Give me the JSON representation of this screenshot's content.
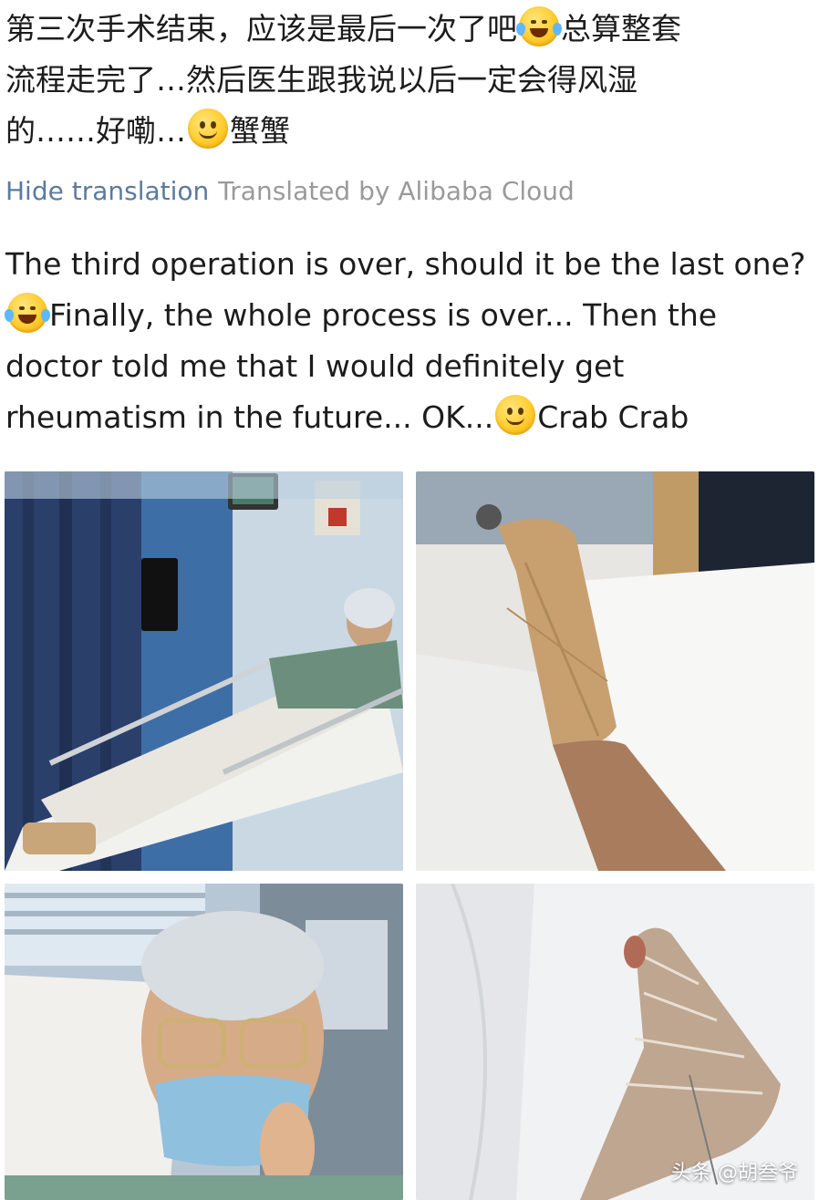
{
  "post": {
    "line1": "第三次手术结束，应该是最后一次了吧",
    "line1b": "总算整套",
    "line2": "流程走完了…然后医生跟我说以后一定会得风湿",
    "line3a": "的……好嘞…",
    "line3b": "蟹蟹"
  },
  "translation_bar": {
    "hide_label": "Hide translation",
    "provider": "Translated by Alibaba Cloud"
  },
  "translated": {
    "part1": "The third operation is over, should it be the last one?",
    "part2": "Finally, the whole process is over... Then the doctor told me that I would definitely get rheumatism in the future... OK...",
    "part3": "Crab Crab"
  },
  "icons": {
    "laugh_emoji": "face-with-tears-of-joy-icon",
    "smile_emoji": "slightly-smiling-face-icon"
  },
  "photos": [
    {
      "name": "hospital-bed-photo"
    },
    {
      "name": "bandaged-leg-photo"
    },
    {
      "name": "selfie-mask-photo"
    },
    {
      "name": "wrapped-foot-photo"
    }
  ],
  "watermark": {
    "text": "头条 @胡叁爷"
  }
}
